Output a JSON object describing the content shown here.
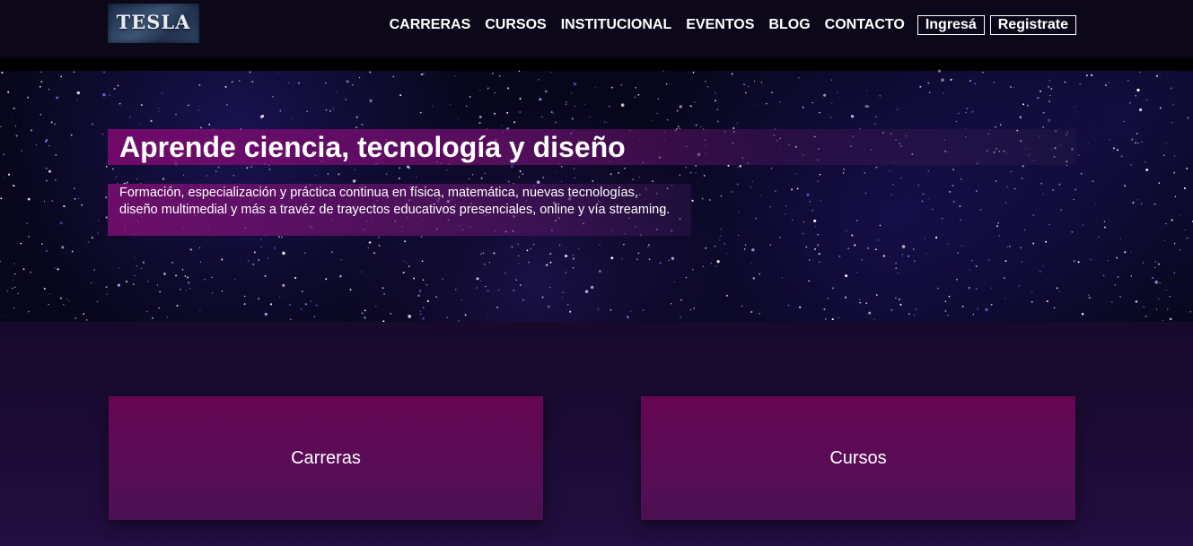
{
  "logo": {
    "text": "TESLA"
  },
  "nav": {
    "items": [
      "CARRERAS",
      "CURSOS",
      "INSTITUCIONAL",
      "EVENTOS",
      "BLOG",
      "CONTACTO"
    ],
    "login": "Ingresá",
    "register": "Registrate"
  },
  "hero": {
    "title": "Aprende ciencia, tecnología y diseño",
    "description": "Formación, especialización y práctica continua en física, matemática, nuevas tecnologías, diseño multimedial y más a travéz de trayectos educativos presenciales, online y vía streaming."
  },
  "cards": [
    "Carreras",
    "Cursos"
  ],
  "colors": {
    "header_bg": "#0d0819",
    "accent_magenta": "#660552",
    "page_bg": "#1d0c37"
  }
}
